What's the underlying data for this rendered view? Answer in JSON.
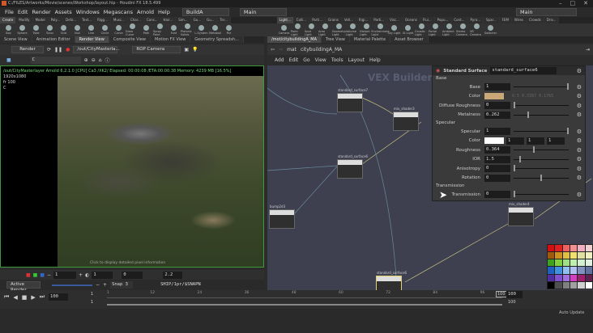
{
  "window": {
    "title": "C:/FILES/Artworks/Movie/scenes/Workshop/layout.hip - Houdini FX 18.5.499",
    "controls": [
      "–",
      "□",
      "✕"
    ]
  },
  "menu": [
    "File",
    "Edit",
    "Render",
    "Assets",
    "Windows",
    "Megascans",
    "Arnold",
    "Help"
  ],
  "desktop": "BuildA",
  "left_context": "Main",
  "right_context": "Main",
  "shelf_tabs_left": [
    "Create",
    "Modify",
    "Model",
    "Poly...",
    "Defo...",
    "Text...",
    "Rigg...",
    "Musc...",
    "Char...",
    "Cons...",
    "Hair...",
    "Sim...",
    "Gu...",
    "Gu...",
    "Ter..."
  ],
  "shelf_tools_left": [
    "Box",
    "Sphere",
    "Tube",
    "Torus",
    "Grid",
    "Null",
    "Line",
    "Circle",
    "Curve",
    "Draw Curve",
    "Path",
    "Spray Paint",
    "Font",
    "Platonic Solids",
    "L-System",
    "Metaball",
    "File"
  ],
  "shelf_tabs_right": [
    "Light...",
    "Colli...",
    "Parti...",
    "Grains",
    "Vell...",
    "Rigi...",
    "Parti...",
    "Visc...",
    "Oceans",
    "Flui...",
    "Popu...",
    "Cont...",
    "Pyro...",
    "Spar...",
    "FEM",
    "Wires",
    "Crowds",
    "Driv..."
  ],
  "shelf_tools_right": [
    "Camera",
    "Point Light",
    "Spot Light",
    "Area Light",
    "Geometry Light",
    "Volume Light",
    "Distant Light",
    "Environment Light",
    "Sky Light",
    "GI Light",
    "Caustic Light",
    "Portal Light",
    "Ambient Light",
    "Stereo Camera",
    "VR Camera",
    "Switcher"
  ],
  "left_pane_tabs": [
    "Scene View",
    "Animation Editor",
    "Render View",
    "Composite View",
    "Motion FX View",
    "Geometry Spreadsh..."
  ],
  "render_toolbar": {
    "render_button": "Render",
    "rop_path": "/out/CityMasterla...",
    "camera": "ROP Camera",
    "aov": "C"
  },
  "render_overlay": {
    "path": "/out/CityMasterlayer",
    "info": "Arnold 6.2.1.0 [CPU] Ca3 /XK2/ Elapsed: 00:00:08 /ETA:00:00:38  Memory: 4239 MB  [16.5%]",
    "resolution": "1920x1080",
    "frame": "fr 100",
    "channel": "C",
    "footer": "Click to display detailed pixel information"
  },
  "render_bottom": {
    "exposure": "1",
    "gamma_field": "1",
    "offset": "0",
    "gamma": "2.2",
    "active_render": "Active Render",
    "snap": "Snap 3",
    "ship_path": "SHIP/1pr/$SNAPN"
  },
  "right_pane_tabs": [
    "/mot/citybuildingA_MA",
    "Tree View",
    "Material Palette",
    "Asset Browser"
  ],
  "network_path": [
    "mat",
    "citybuildingA_MA"
  ],
  "network_menu": [
    "Add",
    "Edit",
    "Go",
    "View",
    "Tools",
    "Layout",
    "Help"
  ],
  "network_label": "VEX Builder",
  "nodes": [
    {
      "name": "standard_surface7"
    },
    {
      "name": "mix_shader3"
    },
    {
      "name": "standard_surface6"
    },
    {
      "name": "bump2d3"
    },
    {
      "name": "mix_shader4"
    },
    {
      "name": "standard_surface6"
    }
  ],
  "params": {
    "type": "Standard Surface",
    "node_name": "standard_surface6",
    "base_section": "Base",
    "base": [
      {
        "label": "Base",
        "value": "1",
        "slider": 1.0
      },
      {
        "label": "Color",
        "value": "0.5   0.3397  0.1765",
        "swatch": "#c9a777"
      },
      {
        "label": "Diffuse Roughness",
        "value": "0",
        "slider": 0
      },
      {
        "label": "Metalness",
        "value": "0.262",
        "slider": 0.262
      }
    ],
    "specular_section": "Specular",
    "specular": [
      {
        "label": "Specular",
        "value": "1",
        "slider": 1.0
      },
      {
        "label": "Color",
        "values": [
          "1",
          "1",
          "1"
        ],
        "swatch": "#ffffff"
      },
      {
        "label": "Roughness",
        "value": "0.364",
        "slider": 0.364
      },
      {
        "label": "IOR",
        "value": "1.5",
        "slider": 0.1
      },
      {
        "label": "Anisotropy",
        "value": "0",
        "slider": 0
      },
      {
        "label": "Rotation",
        "value": "0",
        "slider": 0.5
      }
    ],
    "transmission_section": "Transmission",
    "transmission": [
      {
        "label": "Transmission",
        "value": "0",
        "slider": 0
      }
    ]
  },
  "palette": [
    "#d01010",
    "#e02020",
    "#f06060",
    "#f09090",
    "#f0b0c0",
    "#f0d0d0",
    "#a05a10",
    "#d09020",
    "#e0c040",
    "#f0e070",
    "#e0e0a0",
    "#f0f0c0",
    "#40a020",
    "#80d040",
    "#a0e080",
    "#c0f0b0",
    "#d0f0d0",
    "#e0f0e0",
    "#2060c0",
    "#4090e0",
    "#90c0f0",
    "#b0c0f0",
    "#8090c0",
    "#6070a0",
    "#5030a0",
    "#8050d0",
    "#a070e0",
    "#d040c0",
    "#a02070",
    "#602050",
    "#000000",
    "#505050",
    "#808080",
    "#a0a0a0",
    "#d0d0d0",
    "#ffffff"
  ],
  "timeline": {
    "current_frame": "100",
    "start": "1",
    "end_field": "1",
    "ticks": [
      "1",
      "12",
      "24",
      "36",
      "48",
      "60",
      "72",
      "84",
      "96"
    ],
    "end_marker": "100",
    "range_end": "100",
    "range_end2": "100",
    "auto_update": "Auto Update"
  }
}
